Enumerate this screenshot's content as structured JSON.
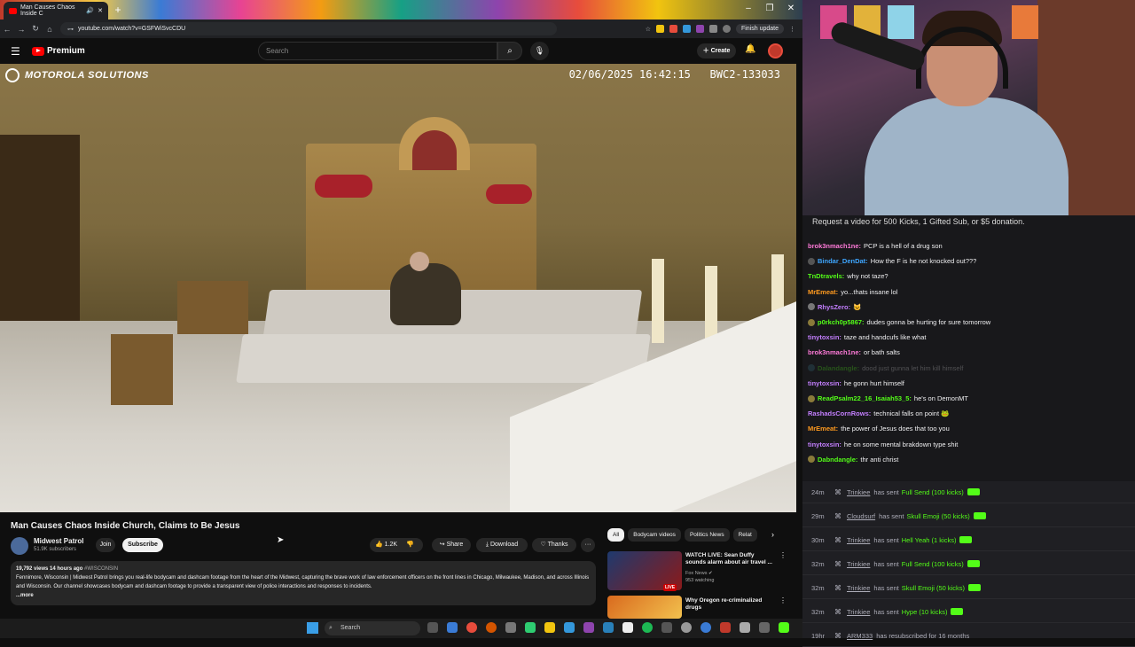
{
  "browser": {
    "tab_title": "Man Causes Chaos Inside C",
    "new_tab": "+",
    "url": "youtube.com/watch?v=GSFWiSvcCDU",
    "finish_update": "Finish update",
    "window_buttons": [
      "–",
      "❐",
      "✕"
    ]
  },
  "youtube": {
    "brand": "Premium",
    "search_placeholder": "Search",
    "create_label": "Create"
  },
  "video": {
    "overlay_brand": "MOTOROLA SOLUTIONS",
    "overlay_stamp": "02/06/2025 16:42:15   BWC2-133033",
    "title": "Man Causes Chaos Inside Church, Claims to Be Jesus",
    "channel": "Midwest Patrol",
    "subscribers": "51.9K subscribers",
    "join": "Join",
    "subscribe": "Subscribe",
    "likes": "1.2K",
    "share": "Share",
    "download": "Download",
    "thanks": "Thanks",
    "more": "···",
    "desc_meta": "19,792 views  14 hours ago",
    "desc_tag": "#WISCONSIN",
    "desc_text": "Fennimore, Wisconsin | Midwest Patrol brings you real-life bodycam and dashcam footage from the heart of the Midwest, capturing the brave work of law enforcement officers on the front lines in Chicago, Milwaukee, Madison, and across Illinois and Wisconsin. Our channel showcases bodycam and dashcam footage to provide a transparent view of police interactions and responses to incidents.",
    "desc_more": "...more"
  },
  "related": {
    "chips": [
      "All",
      "Bodycam videos",
      "Politics News",
      "Relat"
    ],
    "items": [
      {
        "title": "WATCH LIVE: Sean Duffy sounds alarm about air travel ...",
        "channel": "Fox News ✔",
        "meta": "953 watching",
        "badge": "LIVE",
        "thumb_color": "#1e3a6e"
      },
      {
        "title": "Why Oregon re-criminalized drugs",
        "channel": "",
        "meta": "",
        "badge": "",
        "thumb_color": "#d96a1e"
      }
    ]
  },
  "chat": {
    "notice": "Request a video for 500 Kicks, 1 Gifted Sub, or $5 donation.",
    "messages": [
      {
        "user": "brok3nmach1ne:",
        "text": "PCP is a hell of a drug son",
        "color": "#ff7ad9",
        "badge": ""
      },
      {
        "user": "Bindar_DenDat:",
        "text": "How the F is he not knocked out???",
        "color": "#3ea6ff",
        "badge": "#555"
      },
      {
        "user": "TnDtravels:",
        "text": "why not taze?",
        "color": "#53fc18",
        "badge": ""
      },
      {
        "user": "MrEmeat:",
        "text": "yo...thats insane lol",
        "color": "#ff9a1f",
        "badge": ""
      },
      {
        "user": "RhysZero:",
        "text": "😺",
        "color": "#c47fff",
        "badge": "#777"
      },
      {
        "user": "p0rkch0p5867:",
        "text": "dudes gonna be hurting for sure tomorrow",
        "color": "#53fc18",
        "badge": "#8a7a3a"
      },
      {
        "user": "tinytoxsin:",
        "text": "taze and handcufs like what",
        "color": "#c47fff",
        "badge": ""
      },
      {
        "user": "brok3nmach1ne:",
        "text": "or bath salts",
        "color": "#ff7ad9",
        "badge": ""
      },
      {
        "user": "Dalandangle:",
        "text": "dood just gunna let him kill himself",
        "color": "#53fc18",
        "badge": "#3a7a8a"
      },
      {
        "user": "tinytoxsin:",
        "text": "he gonn hurt himself",
        "color": "#c47fff",
        "badge": ""
      },
      {
        "user": "ReadPsalm22_16_Isaiah53_5:",
        "text": "he's on DemonMT",
        "color": "#53fc18",
        "badge": "#8a7a3a"
      },
      {
        "user": "RashadsCornRows:",
        "text": "technical falls on point 🐸",
        "color": "#c47fff",
        "badge": ""
      },
      {
        "user": "MrEmeat:",
        "text": "the power of Jesus does that too you",
        "color": "#ff9a1f",
        "badge": ""
      },
      {
        "user": "tinytoxsin:",
        "text": "he on some mental brakdown type shit",
        "color": "#c47fff",
        "badge": ""
      },
      {
        "user": "Dabndangle:",
        "text": "thr anti christ",
        "color": "#53fc18",
        "badge": "#8a7a3a"
      }
    ]
  },
  "events": [
    {
      "time": "24m",
      "user": "Trinkiee",
      "action": "has sent",
      "reward": "Full Send (100 kicks)"
    },
    {
      "time": "29m",
      "user": "Cloudsurf",
      "action": "has sent",
      "reward": "Skull Emoji (50 kicks)"
    },
    {
      "time": "30m",
      "user": "Trinkiee",
      "action": "has sent",
      "reward": "Hell Yeah (1 kicks)"
    },
    {
      "time": "32m",
      "user": "Trinkiee",
      "action": "has sent",
      "reward": "Full Send (100 kicks)"
    },
    {
      "time": "32m",
      "user": "Trinkiee",
      "action": "has sent",
      "reward": "Skull Emoji (50 kicks)"
    },
    {
      "time": "32m",
      "user": "Trinkiee",
      "action": "has sent",
      "reward": "Hype (10 kicks)"
    },
    {
      "time": "19hr",
      "user": "ARM333",
      "action": "has resubscribed for 16 months",
      "reward": ""
    }
  ],
  "taskbar": {
    "search": "Search"
  }
}
